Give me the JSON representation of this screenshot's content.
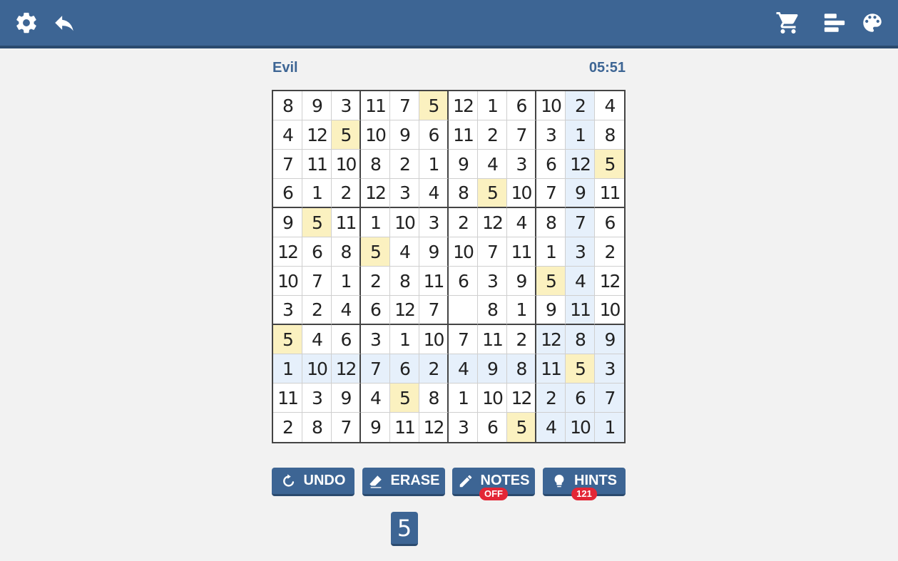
{
  "header": {
    "icons": [
      "gear-icon",
      "undo-arrow-icon",
      "cart-icon",
      "stats-bars-icon",
      "palette-icon"
    ]
  },
  "game": {
    "difficulty": "Evil",
    "timer": "05:51"
  },
  "board": {
    "size": 12,
    "box_rows": 4,
    "box_cols": 3,
    "selected_number": "5",
    "cells": [
      [
        "8",
        "9",
        "3",
        "11",
        "7",
        "5",
        "12",
        "1",
        "6",
        "10",
        "2",
        "4"
      ],
      [
        "4",
        "12",
        "5",
        "10",
        "9",
        "6",
        "11",
        "2",
        "7",
        "3",
        "1",
        "8"
      ],
      [
        "7",
        "11",
        "10",
        "8",
        "2",
        "1",
        "9",
        "4",
        "3",
        "6",
        "12",
        "5"
      ],
      [
        "6",
        "1",
        "2",
        "12",
        "3",
        "4",
        "8",
        "5",
        "10",
        "7",
        "9",
        "11"
      ],
      [
        "9",
        "5",
        "11",
        "1",
        "10",
        "3",
        "2",
        "12",
        "4",
        "8",
        "7",
        "6"
      ],
      [
        "12",
        "6",
        "8",
        "5",
        "4",
        "9",
        "10",
        "7",
        "11",
        "1",
        "3",
        "2"
      ],
      [
        "10",
        "7",
        "1",
        "2",
        "8",
        "11",
        "6",
        "3",
        "9",
        "5",
        "4",
        "12"
      ],
      [
        "3",
        "2",
        "4",
        "6",
        "12",
        "7",
        "",
        "8",
        "1",
        "9",
        "11",
        "10"
      ],
      [
        "5",
        "4",
        "6",
        "3",
        "1",
        "10",
        "7",
        "11",
        "2",
        "12",
        "8",
        "9"
      ],
      [
        "1",
        "10",
        "12",
        "7",
        "6",
        "2",
        "4",
        "9",
        "8",
        "11",
        "5",
        "3"
      ],
      [
        "11",
        "3",
        "9",
        "4",
        "5",
        "8",
        "1",
        "10",
        "12",
        "2",
        "6",
        "7"
      ],
      [
        "2",
        "8",
        "7",
        "9",
        "11",
        "12",
        "3",
        "6",
        "5",
        "4",
        "10",
        "1"
      ]
    ],
    "highlight_colors": {
      "same_number": "#fbf1c0",
      "region": "#e6f0fb"
    }
  },
  "controls": {
    "undo_label": "UNDO",
    "erase_label": "ERASE",
    "notes_label": "NOTES",
    "notes_badge": "OFF",
    "hints_label": "HINTS",
    "hints_badge": "121"
  },
  "number_pad": {
    "keys": [
      "5"
    ]
  }
}
